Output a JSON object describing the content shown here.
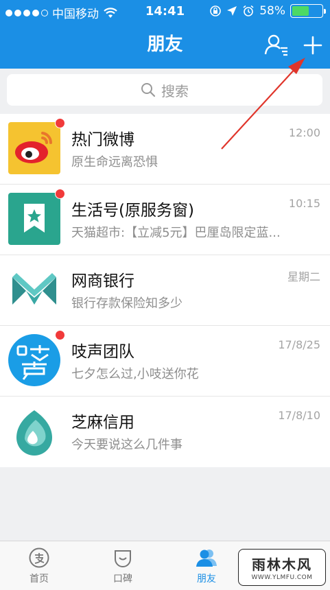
{
  "status_bar": {
    "carrier": "中国移动",
    "time": "14:41",
    "battery": "58%",
    "battery_level": 0.58
  },
  "nav": {
    "title": "朋友",
    "contacts_icon": "contacts-icon",
    "add_icon": "plus-icon"
  },
  "search": {
    "placeholder": "搜索"
  },
  "conversations": [
    {
      "title": "热门微博",
      "subtitle": "原生命远离恐惧",
      "time": "12:00",
      "unread": true,
      "icon": "weibo-icon"
    },
    {
      "title": "生活号(原服务窗)",
      "subtitle": "天猫超市:【立减5元】巴厘岛限定蓝...",
      "time": "10:15",
      "unread": true,
      "icon": "life-account-icon"
    },
    {
      "title": "网商银行",
      "subtitle": "银行存款保险知多少",
      "time": "星期二",
      "unread": false,
      "icon": "mybank-icon"
    },
    {
      "title": "吱声团队",
      "subtitle": "七夕怎么过,小吱送你花",
      "time": "17/8/25",
      "unread": true,
      "icon": "zhisheng-icon"
    },
    {
      "title": "芝麻信用",
      "subtitle": "今天要说这么几件事",
      "time": "17/8/10",
      "unread": false,
      "icon": "sesame-credit-icon"
    }
  ],
  "tabbar": {
    "tabs": [
      {
        "label": "首页",
        "icon": "alipay-home-icon",
        "active": false
      },
      {
        "label": "口碑",
        "icon": "koubei-icon",
        "active": false
      },
      {
        "label": "朋友",
        "icon": "friends-icon",
        "active": true
      }
    ]
  },
  "watermark": {
    "text": "雨林木风",
    "url": "WWW.YLMFU.COM"
  },
  "colors": {
    "primary": "#1b8fe5",
    "unread_dot": "#f13a3a",
    "annotation_arrow": "#e0352b"
  }
}
